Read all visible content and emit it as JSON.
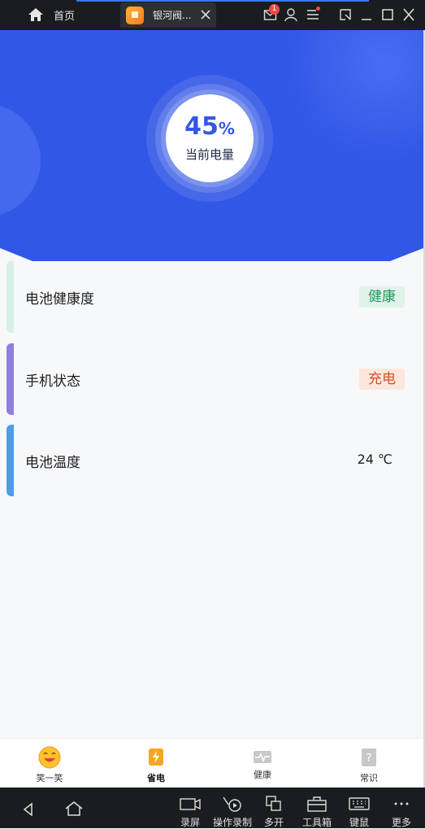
{
  "emulator": {
    "home_label": "首页",
    "tab_title": "银河阀...",
    "mail_badge": "1",
    "toolbar": [
      {
        "label": "录屏",
        "icon": "video-camera-icon"
      },
      {
        "label": "操作录制",
        "icon": "macro-record-icon"
      },
      {
        "label": "多开",
        "icon": "multi-instance-icon"
      },
      {
        "label": "工具箱",
        "icon": "toolbox-icon"
      },
      {
        "label": "键鼠",
        "icon": "keyboard-icon"
      },
      {
        "label": "更多",
        "icon": "more-icon"
      }
    ]
  },
  "battery": {
    "percent": "45",
    "percent_sign": "%",
    "label": "当前电量"
  },
  "cards": [
    {
      "label": "电池健康度",
      "tag": "健康",
      "accent": "#d7f0e4",
      "tag_bg": "#dff3ea",
      "tag_color": "#1e9a5c"
    },
    {
      "label": "手机状态",
      "tag": "充电",
      "accent": "#8f7fe0",
      "tag_bg": "#fde6dc",
      "tag_color": "#d2532a"
    },
    {
      "label": "电池温度",
      "value": "24 ℃",
      "accent": "#4d9de8"
    }
  ],
  "tabs": [
    {
      "label": "笑一笑",
      "icon": "laugh-emoji-icon"
    },
    {
      "label": "省电",
      "icon": "power-save-icon",
      "active": true
    },
    {
      "label": "健康",
      "icon": "health-pulse-icon"
    },
    {
      "label": "常识",
      "icon": "question-help-icon"
    }
  ],
  "colors": {
    "hero_blue": "#3157e6",
    "emulator_bar": "#1b1c1f"
  }
}
